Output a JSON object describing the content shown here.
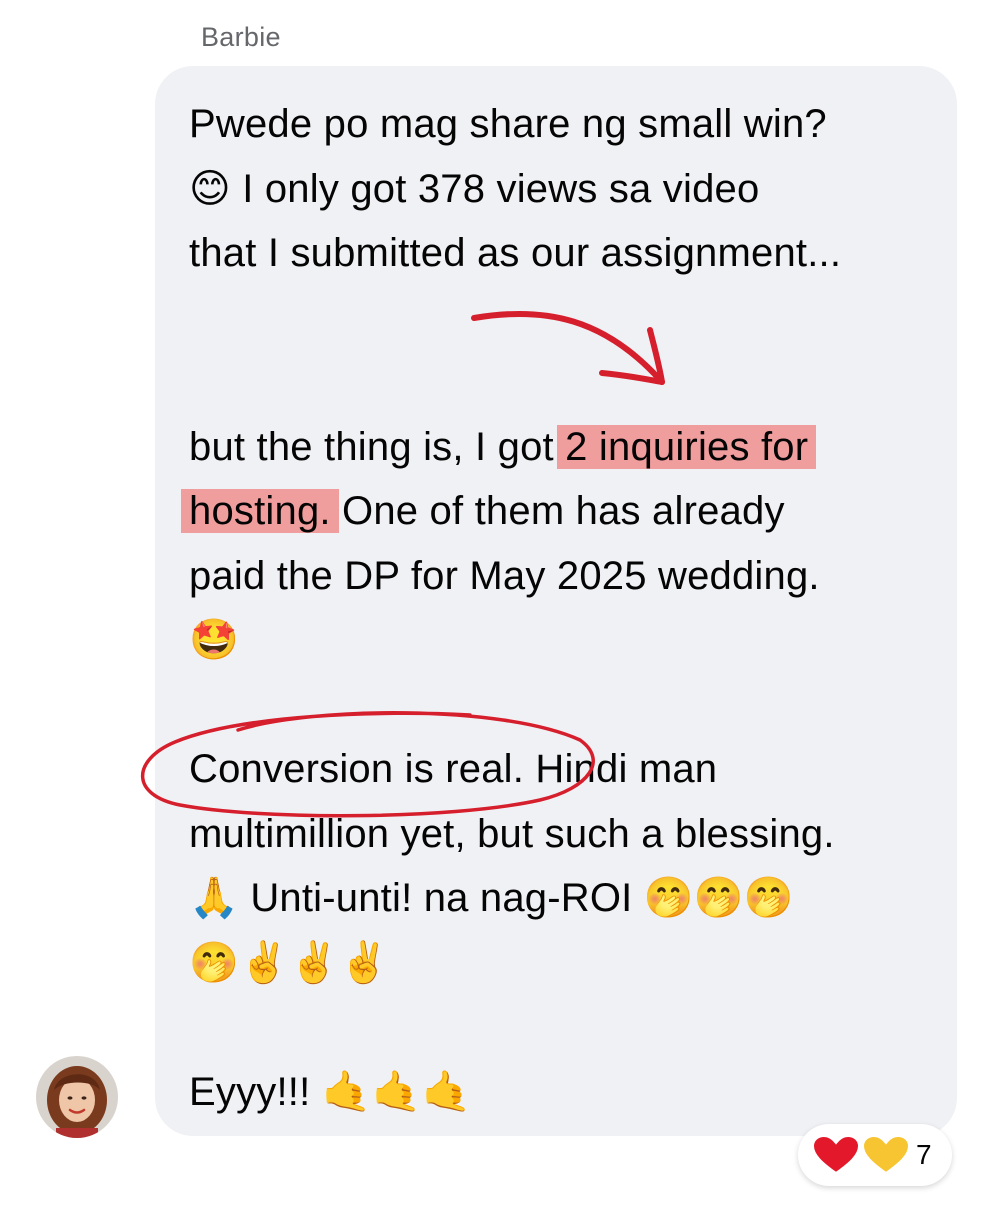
{
  "post": {
    "sender_name": "Barbie",
    "line1": "Pwede po mag share ng small win?",
    "line2_emoji": "😊",
    "line2_text": " I only got 378 views sa video",
    "line3": "that I submitted as our assignment...",
    "line4_pre": "but the thing is, I got ",
    "highlight_1": "2 inquiries for",
    "highlight_2": "hosting.",
    "line5_post": " One of them has already",
    "line6": "paid the DP for May 2025 wedding.",
    "line7_emoji": "🤩",
    "circled_text": "Conversion is real.",
    "line8_post": " Hindi man",
    "line9": "multimillion yet, but such a blessing.",
    "line10_emoji": "🙏",
    "line10_text": " Unti-unti! na nag-ROI ",
    "line10_emojis_end": "🤭🤭🤭",
    "line11_emojis": "🤭✌️✌️✌️",
    "line12_text": "Eyyy!!! ",
    "line12_emojis": "🤙🤙🤙"
  },
  "reactions": {
    "icons": [
      "heart-red",
      "heart-yellow"
    ],
    "count": "7"
  },
  "colors": {
    "bubble": "#f0f1f5",
    "highlight": "#f08080",
    "annotation": "#d61f2c",
    "sender": "#65676b"
  }
}
